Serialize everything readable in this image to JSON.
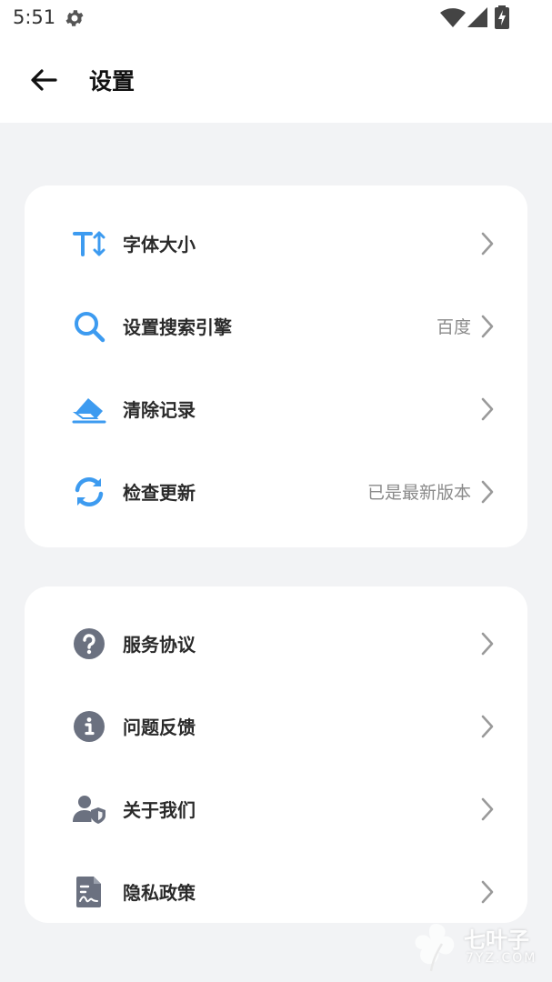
{
  "status_bar": {
    "time": "5:51"
  },
  "app_bar": {
    "title": "设置"
  },
  "colors": {
    "accent_blue": "#3d9bf0",
    "icon_gray": "#6b7180",
    "background": "#f2f3f5"
  },
  "group1": [
    {
      "label": "字体大小",
      "value": "",
      "icon": "font-size-icon"
    },
    {
      "label": "设置搜索引擎",
      "value": "百度",
      "icon": "search-icon"
    },
    {
      "label": "清除记录",
      "value": "",
      "icon": "eraser-icon"
    },
    {
      "label": "检查更新",
      "value": "已是最新版本",
      "icon": "refresh-icon"
    }
  ],
  "group2": [
    {
      "label": "服务协议",
      "value": "",
      "icon": "question-icon"
    },
    {
      "label": "问题反馈",
      "value": "",
      "icon": "info-icon"
    },
    {
      "label": "关于我们",
      "value": "",
      "icon": "user-shield-icon"
    },
    {
      "label": "隐私政策",
      "value": "",
      "icon": "document-icon"
    }
  ],
  "watermark": {
    "text": "七叶子",
    "sub": "7YZ.COM"
  }
}
